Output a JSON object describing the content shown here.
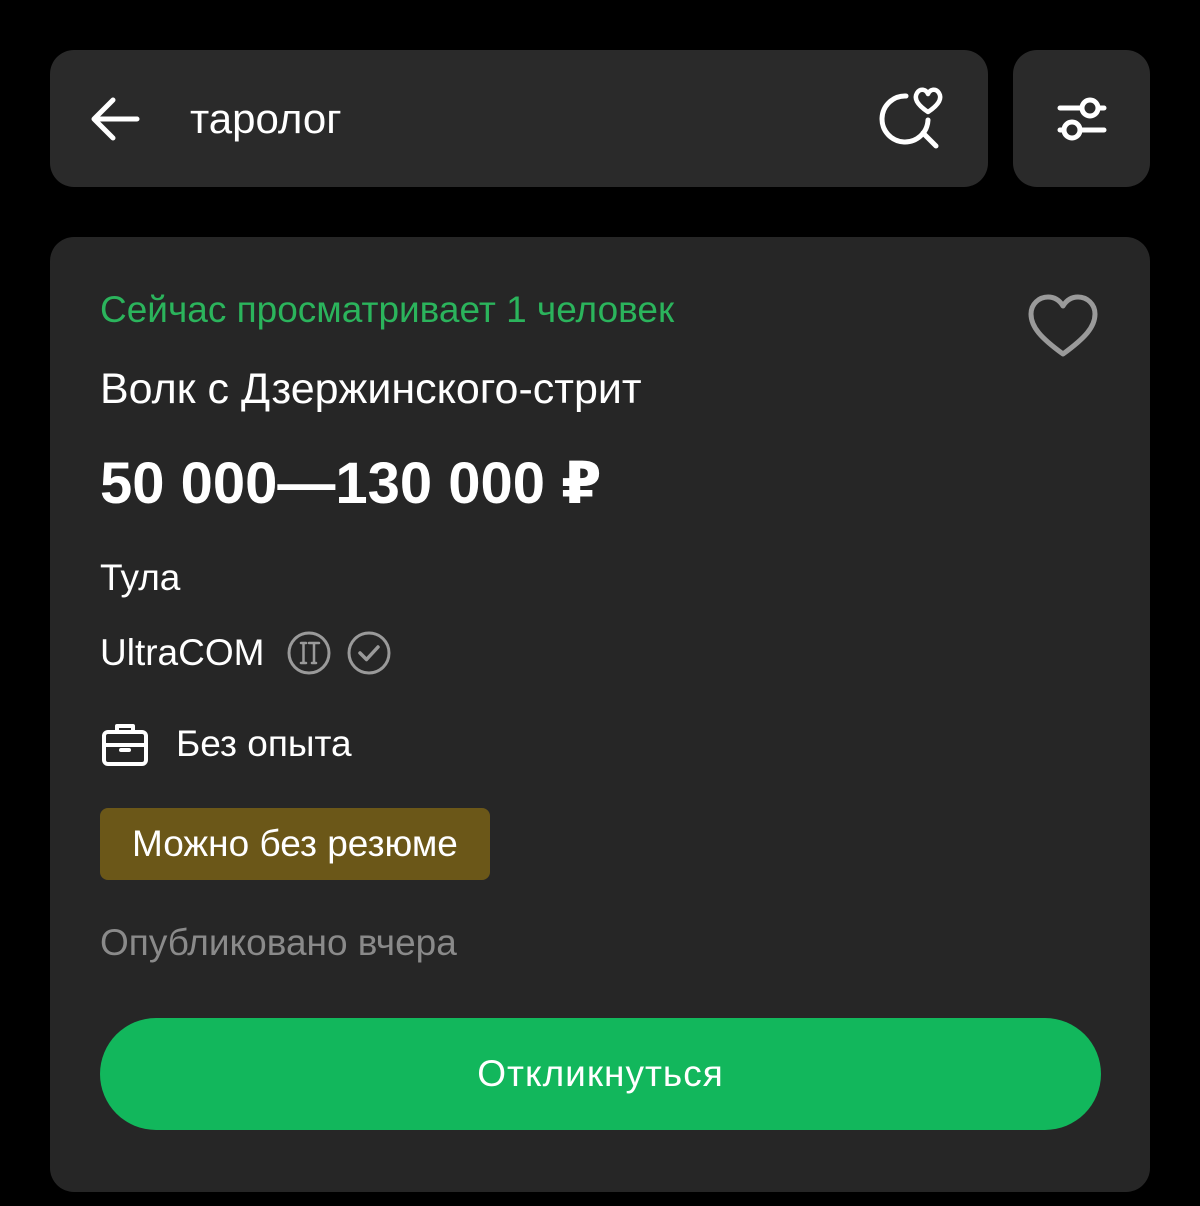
{
  "search": {
    "query": "таролог",
    "icons": {
      "back": "arrow-left-icon",
      "saved_search": "heart-search-icon",
      "filter": "sliders-icon"
    }
  },
  "vacancy": {
    "viewers_text": "Сейчас просматривает 1 человек",
    "title": "Волк с Дзержинского-стрит",
    "salary": "50 000—130 000 ₽",
    "city": "Тула",
    "company": "UltraCOM",
    "company_badges": [
      "it-accredited-icon",
      "verified-check-icon"
    ],
    "experience": "Без опыта",
    "tag": "Можно без резюме",
    "published": "Опубликовано вчера",
    "respond_label": "Откликнуться",
    "icons": {
      "favorite": "heart-outline-icon",
      "experience": "briefcase-icon"
    }
  },
  "colors": {
    "background": "#000000",
    "surface": "#262626",
    "accent_green": "#12b75c",
    "viewers_green": "#2bb45c",
    "tag_background": "#6b5718",
    "muted_text": "#8a8a8a"
  }
}
